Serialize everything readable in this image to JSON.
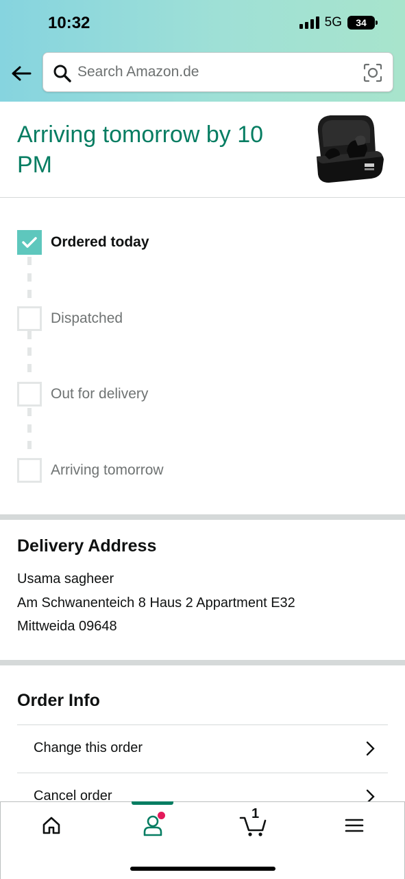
{
  "status_bar": {
    "time": "10:32",
    "network": "5G",
    "battery": "34"
  },
  "search": {
    "placeholder": "Search Amazon.de"
  },
  "arrival": {
    "title": "Arriving tomorrow by 10 PM"
  },
  "tracker": {
    "steps": [
      {
        "label": "Ordered today",
        "done": true
      },
      {
        "label": "Dispatched",
        "done": false
      },
      {
        "label": "Out for delivery",
        "done": false
      },
      {
        "label": "Arriving tomorrow",
        "done": false
      }
    ]
  },
  "address": {
    "title": "Delivery Address",
    "lines": [
      "Usama sagheer",
      "Am Schwanenteich 8 Haus 2 Appartment E32",
      "Mittweida 09648"
    ]
  },
  "order_info": {
    "title": "Order Info",
    "rows": [
      {
        "label": "Change this order"
      },
      {
        "label": "Cancel order"
      }
    ]
  },
  "bottom_nav": {
    "items": [
      "home-icon",
      "account-icon",
      "cart-icon",
      "menu-icon"
    ],
    "cart_count": "1",
    "active": "account-icon"
  },
  "colors": {
    "accent": "#067d62",
    "check": "#5ec7bd",
    "notification": "#e3195a"
  }
}
